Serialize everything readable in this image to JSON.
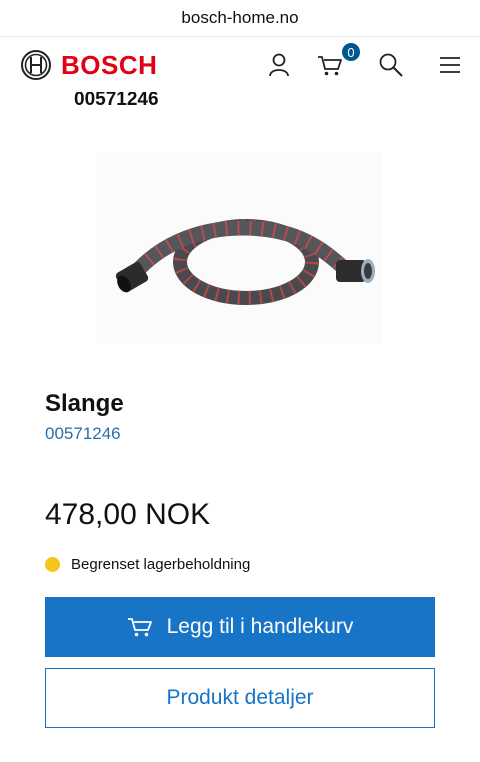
{
  "browser": {
    "url": "bosch-home.no"
  },
  "header": {
    "brand": "BOSCH",
    "cart_count": "0",
    "brand_color": "#e20015",
    "badge_color": "#005691"
  },
  "product": {
    "top_number": "00571246",
    "title": "Slange",
    "sku": "00571246",
    "price": "478,00 NOK",
    "stock_status": "Begrenset lagerbeholdning",
    "stock_color": "#f5c518"
  },
  "actions": {
    "add_to_cart_label": "Legg til i handlekurv",
    "details_label": "Produkt detaljer",
    "accent_color": "#1774c6"
  },
  "icons": [
    "bosch-logo-icon",
    "user-icon",
    "cart-icon",
    "search-icon",
    "menu-icon"
  ]
}
